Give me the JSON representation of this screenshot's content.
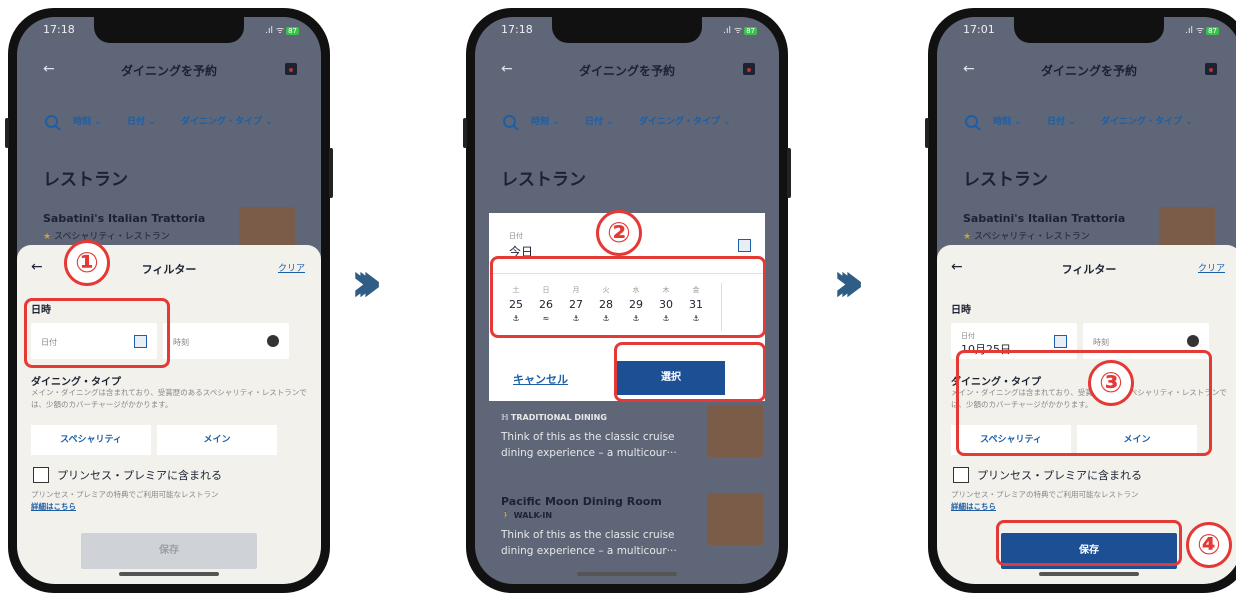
{
  "common": {
    "title": "ダイニングを予約",
    "chips": [
      "時刻",
      "日付",
      "ダイニング・タイプ"
    ],
    "section": "レストラン",
    "restaurant_name": "Sabatini's Italian Trattoria",
    "restaurant_type": "スペシャリティ・レストラン"
  },
  "phone1": {
    "time": "17:18",
    "filter_title": "フィルター",
    "clear": "クリア",
    "datetime_label": "日時",
    "date_label": "日付",
    "time_label": "時刻",
    "dining_type_label": "ダイニング・タイプ",
    "dining_desc": "メイン・ダイニングは含まれており、受賞歴のあるスペシャリティ・レストランでは、少額のカバーチャージがかかります。",
    "specialty": "スペシャリティ",
    "main": "メイン",
    "princess_label": "プリンセス・プレミアに含まれる",
    "princess_note": "プリンセス・プレミアの特典でご利用可能なレストラン",
    "more": "詳細はこちら",
    "save": "保存"
  },
  "phone2": {
    "time": "17:18",
    "date_small": "日付",
    "date_value": "今日",
    "weekdays": [
      "土",
      "日",
      "月",
      "火",
      "水",
      "木",
      "金"
    ],
    "days": [
      "25",
      "26",
      "27",
      "28",
      "29",
      "30",
      "31"
    ],
    "cancel": "キャンセル",
    "select": "選択",
    "traditional": "TRADITIONAL DINING",
    "think": "Think of this as the classic cruise",
    "exp": "dining experience – a multicour···",
    "pacific": "Pacific Moon Dining Room",
    "walkin": "WALK-IN"
  },
  "phone3": {
    "time": "17:01",
    "date_value": "10月25日"
  },
  "markers": [
    "①",
    "②",
    "③",
    "④"
  ],
  "colors": {
    "accent": "#1c5fa7",
    "highlight": "#e53935",
    "arrow": "#2f5d85"
  }
}
